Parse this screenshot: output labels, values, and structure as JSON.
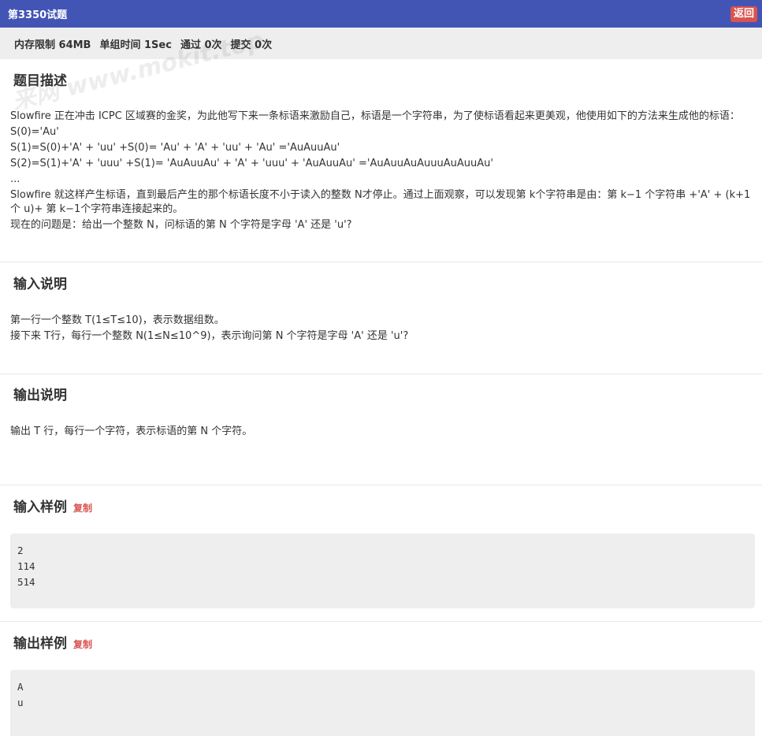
{
  "header": {
    "title": "第3350试题",
    "back_label": "返回"
  },
  "info": {
    "memory": "内存限制 64MB",
    "time": "单组时间 1Sec",
    "passed": "通过 0次",
    "submitted": "提交 0次"
  },
  "watermark": "来网 www.mokit.top",
  "description": {
    "heading": "题目描述",
    "lines": [
      "Slowfire 正在冲击 ICPC 区域赛的金奖，为此他写下来一条标语来激励自己，标语是一个字符串，为了使标语看起来更美观，他使用如下的方法来生成他的标语：",
      "S(0)='Au'",
      "S(1)=S(0)+'A' + 'uu' +S(0)= 'Au' + 'A' + 'uu' + 'Au' ='AuAuuAu'",
      "S(2)=S(1)+'A' + 'uuu' +S(1)= 'AuAuuAu' + 'A' + 'uuu' + 'AuAuuAu' ='AuAuuAuAuuuAuAuuAu'",
      "...",
      "Slowfire 就这样产生标语，直到最后产生的那个标语长度不小于读入的整数 N才停止。通过上面观察，可以发现第 k个字符串是由：第 k−1 个字符串 +'A' + (k+1 个 u)+ 第 k−1个字符串连接起来的。",
      "现在的问题是：给出一个整数 N，问标语的第 N 个字符是字母 'A' 还是 'u'?"
    ]
  },
  "input_desc": {
    "heading": "输入说明",
    "lines": [
      "第一行一个整数 T(1≤T≤10)，表示数据组数。",
      "接下来 T行，每行一个整数 N(1≤N≤10^9)，表示询问第 N 个字符是字母 'A' 还是 'u'?"
    ]
  },
  "output_desc": {
    "heading": "输出说明",
    "lines": [
      "输出 T 行，每行一个字符，表示标语的第 N 个字符。"
    ]
  },
  "sample_input": {
    "heading": "输入样例",
    "copy_label": "复制",
    "lines": [
      "2",
      "114",
      "514"
    ]
  },
  "sample_output": {
    "heading": "输出样例",
    "copy_label": "复制",
    "lines": [
      "A",
      "u"
    ]
  }
}
